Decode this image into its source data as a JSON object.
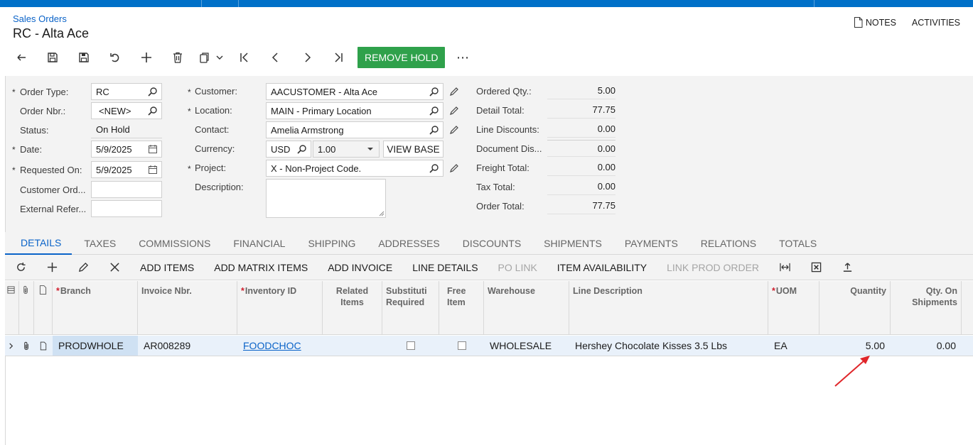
{
  "header": {
    "breadcrumb": "Sales Orders",
    "title": "RC - Alta Ace",
    "notes_label": "NOTES",
    "activities_label": "ACTIVITIES"
  },
  "toolbar": {
    "remove_hold_label": "REMOVE HOLD",
    "more_label": "⋯",
    "icons": [
      "back-icon",
      "save-icon",
      "save-close-icon",
      "undo-icon",
      "add-icon",
      "delete-icon",
      "copy-icon",
      "chevron-down-icon",
      "first-icon",
      "prev-icon",
      "next-icon",
      "last-icon"
    ]
  },
  "form": {
    "order_type_label": "Order Type:",
    "order_type_value": "RC",
    "order_nbr_label": "Order Nbr.:",
    "order_nbr_value": "<NEW>",
    "status_label": "Status:",
    "status_value": "On Hold",
    "date_label": "Date:",
    "date_value": "5/9/2025",
    "requested_on_label": "Requested On:",
    "requested_on_value": "5/9/2025",
    "customer_ord_label": "Customer Ord...",
    "customer_ord_value": "",
    "external_ref_label": "External Refer...",
    "external_ref_value": "",
    "customer_label": "Customer:",
    "customer_value": "AACUSTOMER - Alta Ace",
    "location_label": "Location:",
    "location_value": "MAIN - Primary Location",
    "contact_label": "Contact:",
    "contact_value": "Amelia Armstrong",
    "currency_label": "Currency:",
    "currency_value": "USD",
    "currency_rate": "1.00",
    "view_base_label": "VIEW BASE",
    "project_label": "Project:",
    "project_value": "X - Non-Project Code.",
    "description_label": "Description:",
    "description_value": ""
  },
  "totals": {
    "ordered_qty_label": "Ordered Qty.:",
    "ordered_qty_value": "5.00",
    "detail_total_label": "Detail Total:",
    "detail_total_value": "77.75",
    "line_discounts_label": "Line Discounts:",
    "line_discounts_value": "0.00",
    "document_dis_label": "Document Dis...",
    "document_dis_value": "0.00",
    "freight_total_label": "Freight Total:",
    "freight_total_value": "0.00",
    "tax_total_label": "Tax Total:",
    "tax_total_value": "0.00",
    "order_total_label": "Order Total:",
    "order_total_value": "77.75"
  },
  "tabs": [
    {
      "label": "DETAILS",
      "active": true
    },
    {
      "label": "TAXES"
    },
    {
      "label": "COMMISSIONS"
    },
    {
      "label": "FINANCIAL"
    },
    {
      "label": "SHIPPING"
    },
    {
      "label": "ADDRESSES"
    },
    {
      "label": "DISCOUNTS"
    },
    {
      "label": "SHIPMENTS"
    },
    {
      "label": "PAYMENTS"
    },
    {
      "label": "RELATIONS"
    },
    {
      "label": "TOTALS"
    }
  ],
  "grid_toolbar": {
    "add_items": "ADD ITEMS",
    "add_matrix_items": "ADD MATRIX ITEMS",
    "add_invoice": "ADD INVOICE",
    "line_details": "LINE DETAILS",
    "po_link": "PO LINK",
    "item_availability": "ITEM AVAILABILITY",
    "link_prod_order": "LINK PROD ORDER"
  },
  "grid": {
    "headers": {
      "branch": "Branch",
      "invoice_nbr": "Invoice Nbr.",
      "inventory_id": "Inventory ID",
      "related_items_1": "Related",
      "related_items_2": "Items",
      "substitution_1": "Substituti",
      "substitution_2": "Required",
      "free_item_1": "Free",
      "free_item_2": "Item",
      "warehouse": "Warehouse",
      "line_description": "Line Description",
      "uom": "UOM",
      "quantity": "Quantity",
      "qty_on_shipments_1": "Qty. On",
      "qty_on_shipments_2": "Shipments"
    },
    "rows": [
      {
        "branch": "PRODWHOLE",
        "invoice_nbr": "AR008289",
        "inventory_id": "FOODCHOC",
        "warehouse": "WHOLESALE",
        "line_description": "Hershey Chocolate Kisses 3.5 Lbs",
        "uom": "EA",
        "quantity": "5.00",
        "qty_on_shipments": "0.00"
      }
    ]
  },
  "colors": {
    "accent": "#0070c8",
    "remove_hold": "#2fa14b",
    "annotation_arrow": "#e0262a"
  }
}
